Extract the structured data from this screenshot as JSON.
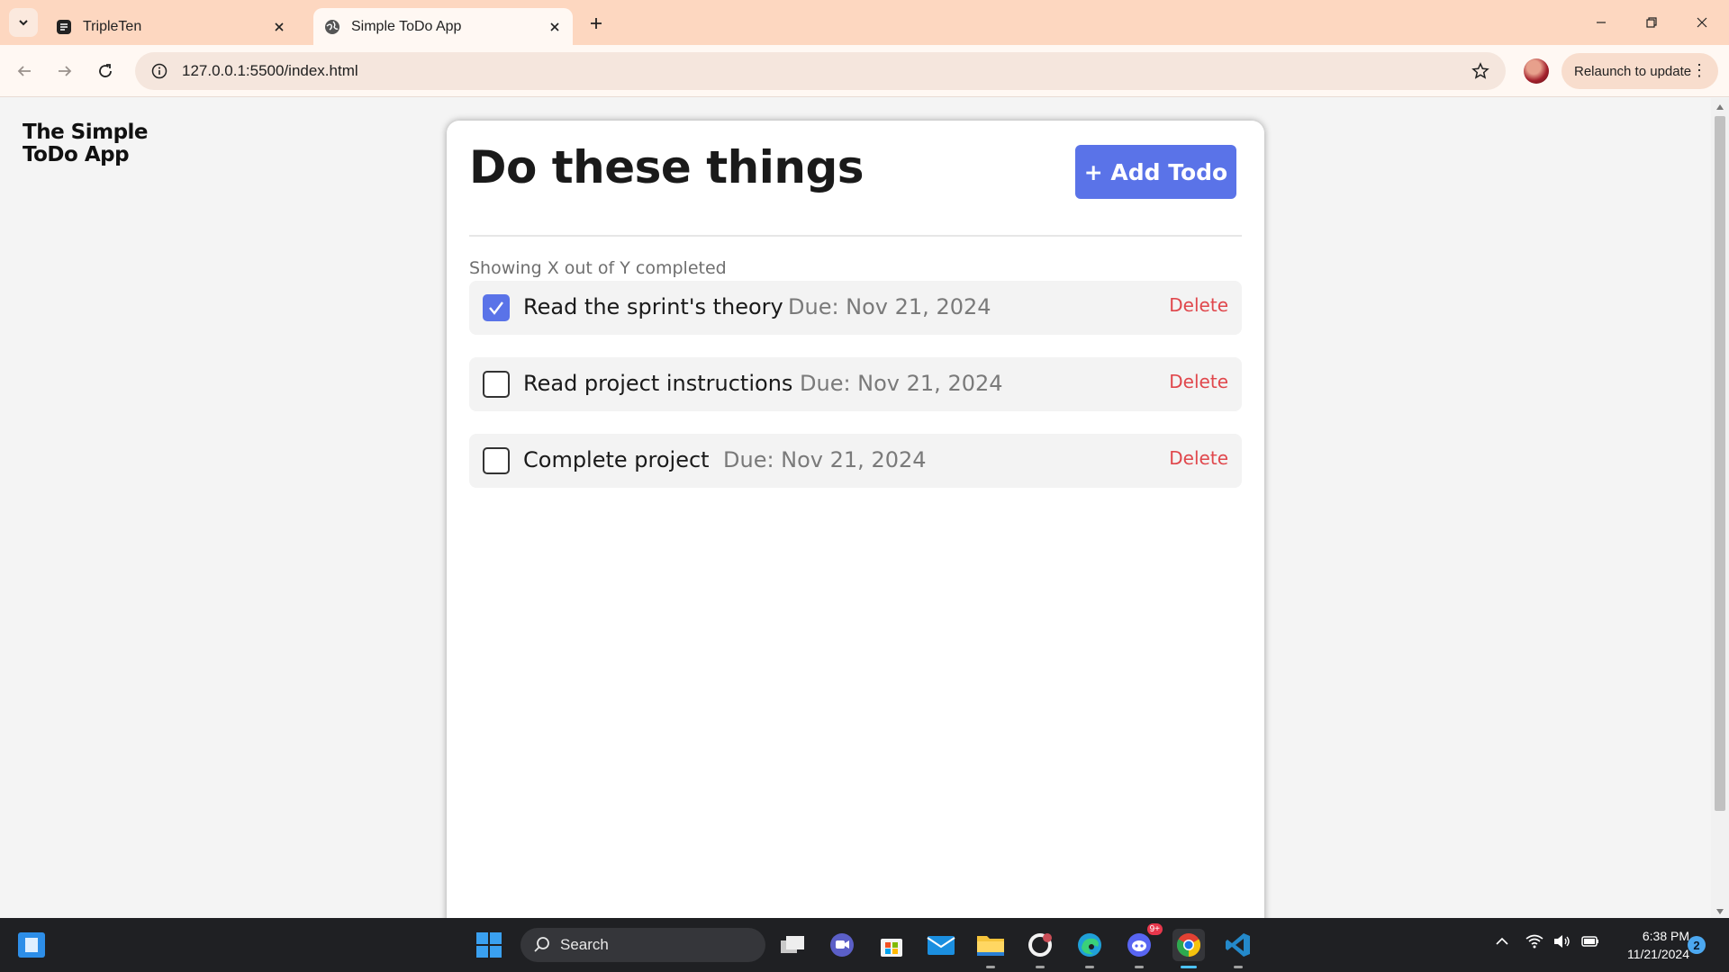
{
  "browser": {
    "tabs": [
      {
        "title": "TripleTen",
        "active": false
      },
      {
        "title": "Simple ToDo App",
        "active": true
      }
    ],
    "url": "127.0.0.1:5500/index.html",
    "relaunch_label": "Relaunch to update"
  },
  "app": {
    "brand": "The Simple ToDo App",
    "title": "Do these things",
    "add_button": "+ Add Todo",
    "counter": "Showing X out of Y completed",
    "delete_label": "Delete",
    "todos": [
      {
        "name": "Read the sprint's theory",
        "due": "Due: Nov 21, 2024",
        "completed": true
      },
      {
        "name": "Read project instructions",
        "due": "Due: Nov 21, 2024",
        "completed": false
      },
      {
        "name": "Complete project",
        "due": "Due: Nov 21, 2024",
        "completed": false
      }
    ],
    "accent_color": "#5a73e8",
    "delete_color": "#e0474c"
  },
  "taskbar": {
    "search_placeholder": "Search",
    "time": "6:38 PM",
    "date": "11/21/2024",
    "notification_count": "2",
    "discord_badge": "9+"
  }
}
